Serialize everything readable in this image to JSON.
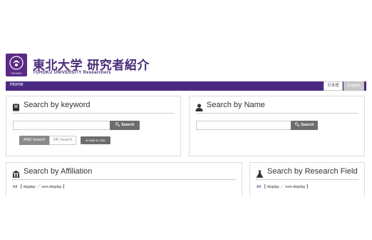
{
  "header": {
    "title_jp": "東北大学 研究者紹介",
    "title_en": "TOHOKU UNIVERSITY Researchers",
    "logo_text": "TOHOKU"
  },
  "navbar": {
    "home": "Home",
    "lang_jp": "日本語",
    "lang_en": "English"
  },
  "keyword_panel": {
    "title": "Search by keyword",
    "input_value": "",
    "search_label": "Search",
    "and_label": "AND Search",
    "or_label": "OR Search",
    "howto_label": "How to Use"
  },
  "name_panel": {
    "title": "Search by Name",
    "input_value": "",
    "search_label": "Search"
  },
  "affil_panel": {
    "title": "Search by Affiliation",
    "all_label": "All",
    "display_label": "【 display ／ non-display 】"
  },
  "field_panel": {
    "title": "Search by Research Field",
    "all_label": "All",
    "display_label": "【 display ／ non-display 】"
  },
  "colors": {
    "brand": "#4b2a82",
    "button": "#6d6d6d"
  }
}
